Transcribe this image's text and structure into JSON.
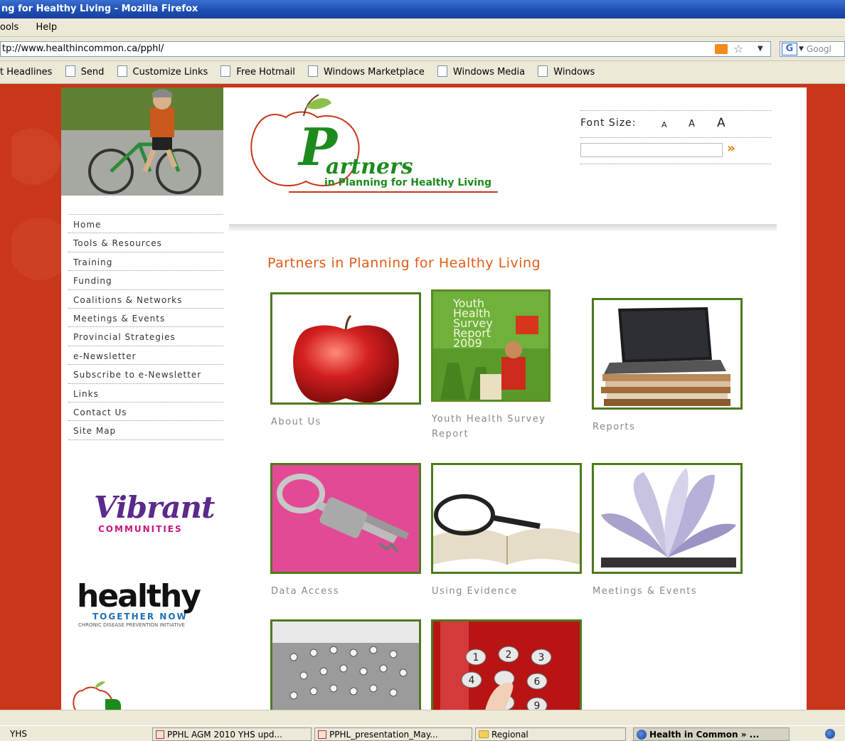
{
  "browser": {
    "title": "ng for Healthy Living - Mozilla Firefox",
    "menus": [
      "ools",
      "Help"
    ],
    "url": "tp://www.healthincommon.ca/pphl/",
    "search_engine_icon": "google-icon",
    "search_placeholder": "Googl",
    "bookmarks": [
      "t Headlines",
      "Send",
      "Customize Links",
      "Free Hotmail",
      "Windows Marketplace",
      "Windows Media",
      "Windows"
    ]
  },
  "header": {
    "logo": {
      "big_letter": "P",
      "word": "artners",
      "tagline": "in Planning for Healthy Living"
    },
    "font_size": {
      "label": "Font Size:",
      "small": "A",
      "medium": "A",
      "large": "A"
    },
    "search": {
      "value": "",
      "go_label": "»"
    }
  },
  "nav": {
    "items": [
      "Home",
      "Tools & Resources",
      "Training",
      "Funding",
      "Coalitions & Networks",
      "Meetings & Events",
      "Provincial Strategies",
      "e-Newsletter",
      "Subscribe to e-Newsletter",
      "Links",
      "Contact Us",
      "Site Map"
    ]
  },
  "sidebar_logos": {
    "vibrant": {
      "word": "Vibrant",
      "sub": "COMMUNITIES"
    },
    "healthy": {
      "word": "healthy",
      "sub1": "TOGETHER NOW",
      "sub2": "CHRONIC DISEASE PREVENTION INITIATIVE"
    }
  },
  "main": {
    "heading": "Partners in Planning for Healthy Living",
    "tiles": [
      {
        "caption": "About Us",
        "image": "apple"
      },
      {
        "caption": "Youth Health Survey Report",
        "image": "youth-health-survey-cover",
        "cover_text": "Youth Health Survey Report 2009"
      },
      {
        "caption": "Reports",
        "image": "laptop-on-papers"
      },
      {
        "caption": "Data Access",
        "image": "keys"
      },
      {
        "caption": "Using Evidence",
        "image": "magnifier-on-book"
      },
      {
        "caption": "Meetings & Events",
        "image": "open-book-pages"
      },
      {
        "caption": "",
        "image": "crowd-figures"
      },
      {
        "caption": "",
        "image": "phone-keypad"
      }
    ]
  },
  "taskbar": {
    "items": [
      "YHS",
      "PPHL AGM 2010 YHS upd...",
      "PPHL_presentation_May...",
      "Regional",
      "Health in Common » ..."
    ]
  },
  "colors": {
    "page_background": "#c9361a",
    "heading_orange": "#e25b16",
    "tile_border_green": "#4e7a1e",
    "logo_green": "#1d8a1d"
  }
}
